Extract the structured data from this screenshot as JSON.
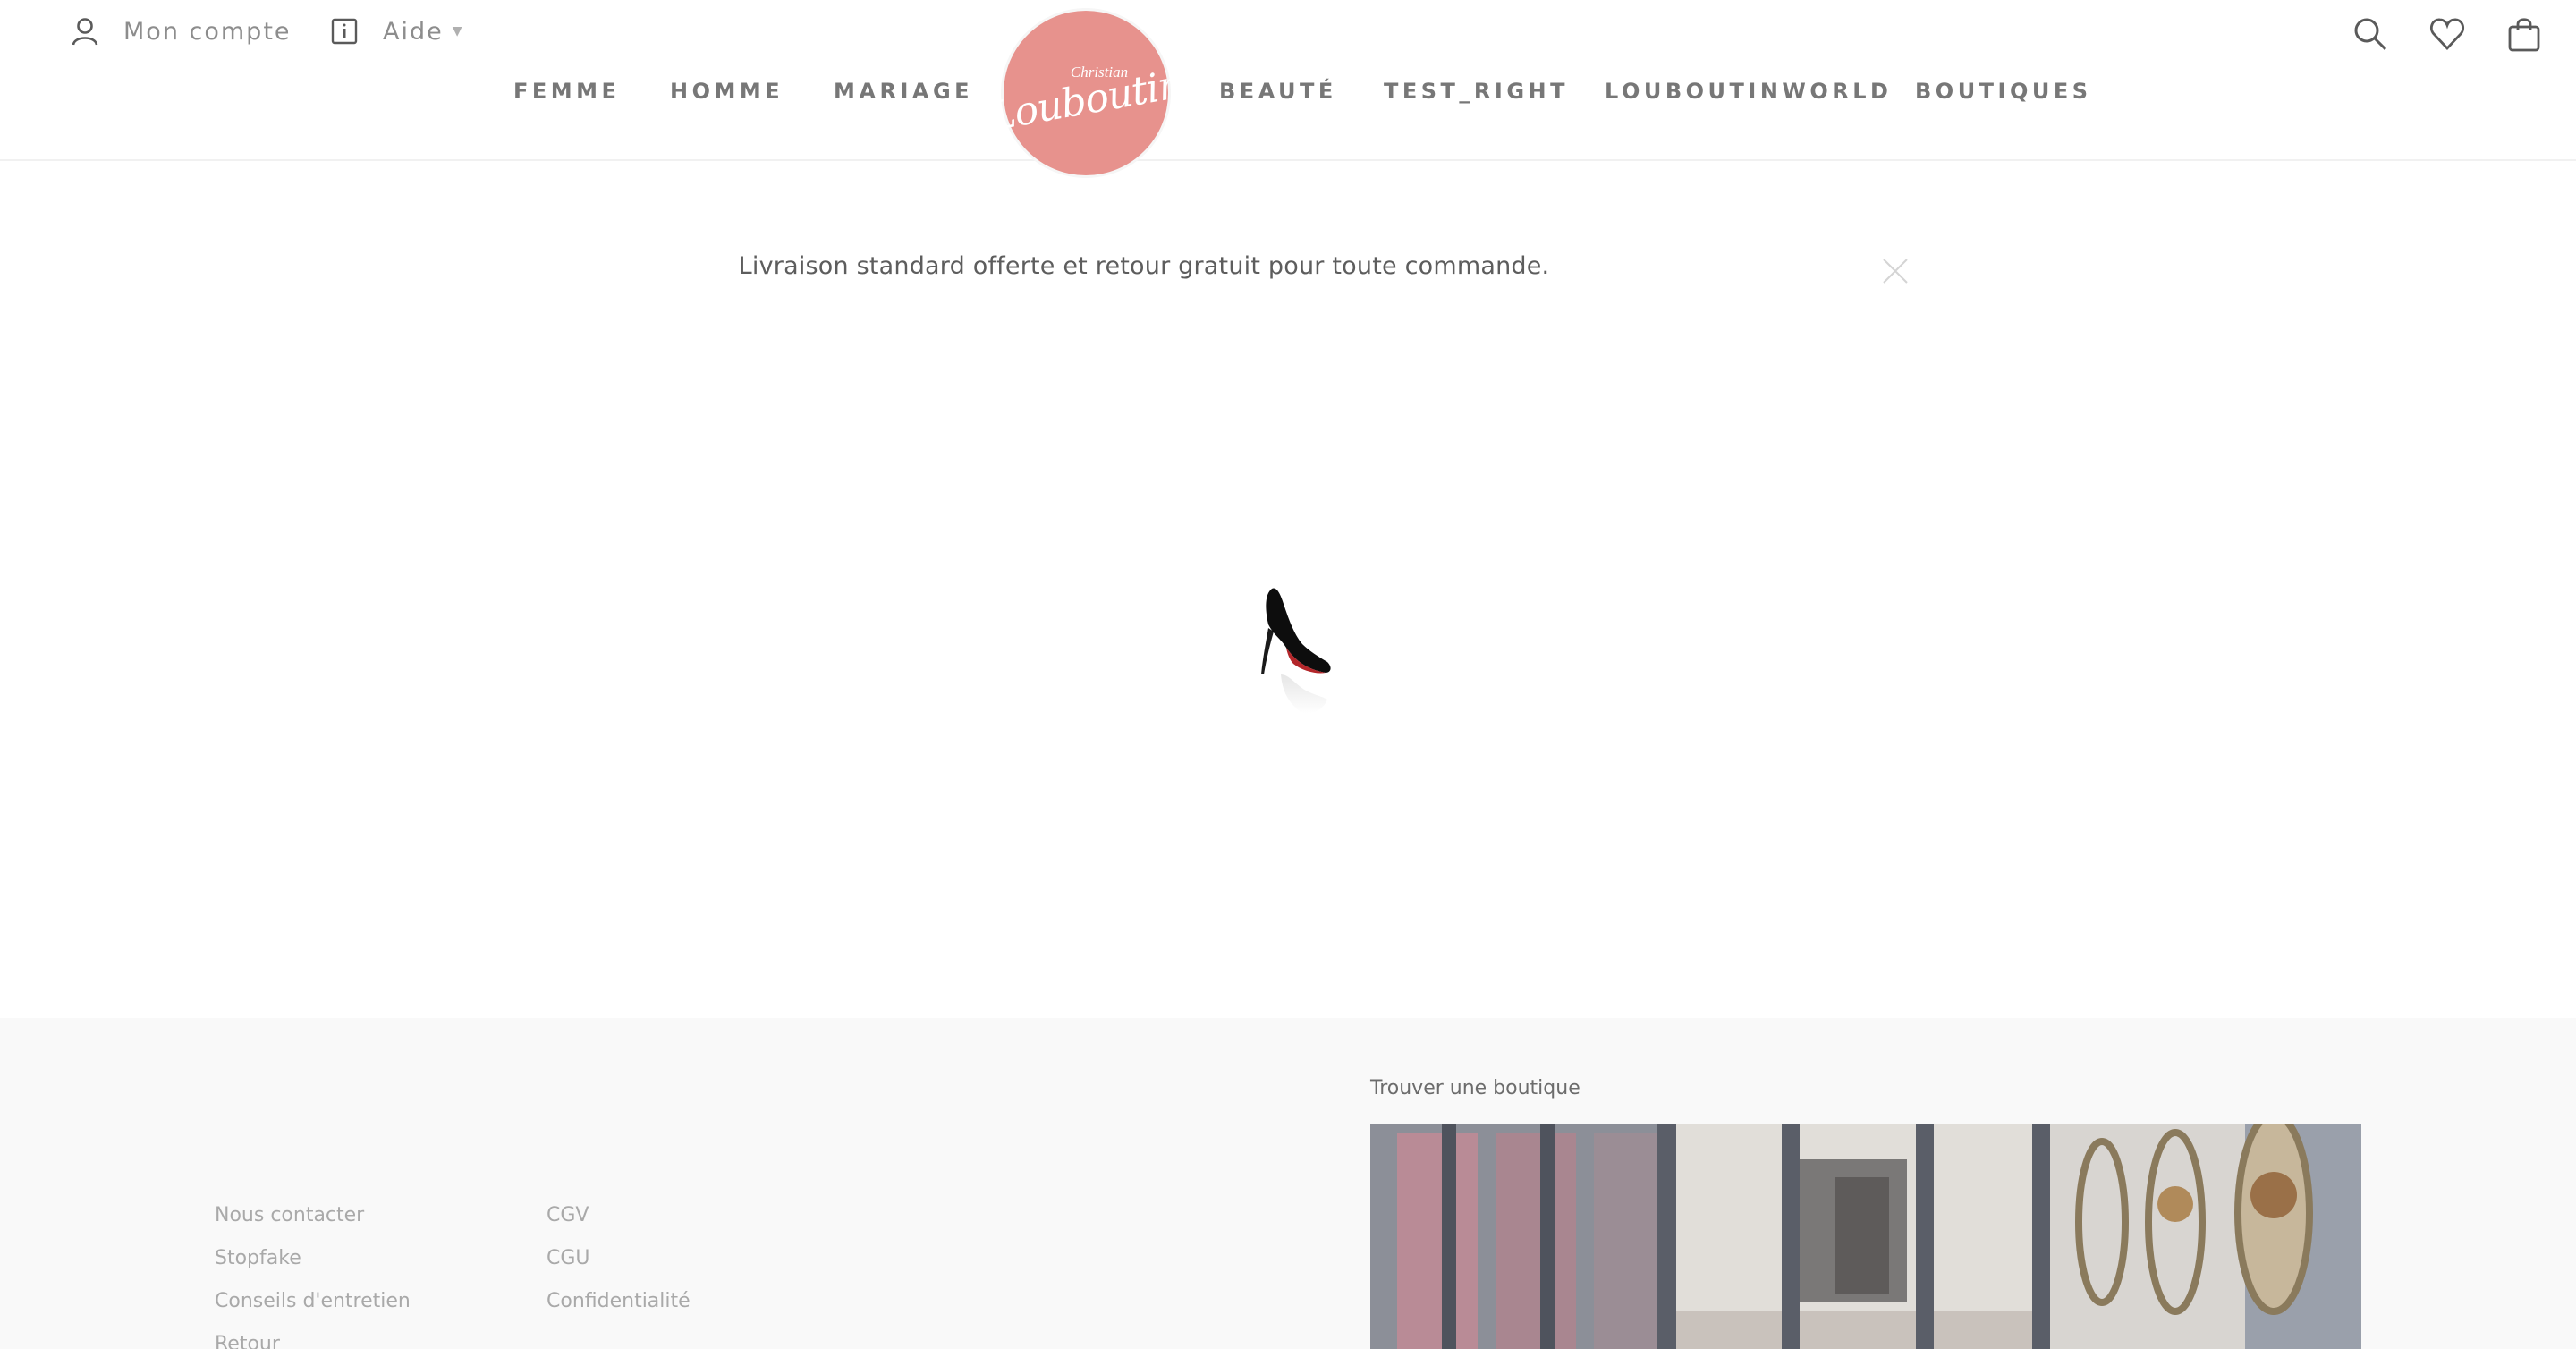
{
  "header": {
    "account_label": "Mon compte",
    "help_label": "Aide",
    "logo_small_text": "Christian",
    "logo_big_text": "Louboutin",
    "brand_color": "#e7928d",
    "icons": [
      "user-icon",
      "info-icon",
      "search-icon",
      "heart-icon",
      "bag-icon"
    ]
  },
  "nav": {
    "items": [
      {
        "label": "FEMME"
      },
      {
        "label": "HOMME"
      },
      {
        "label": "MARIAGE"
      },
      {
        "label": "BEAUTÉ"
      },
      {
        "label": "TEST_RIGHT"
      },
      {
        "label": "LOUBOUTINWORLD"
      },
      {
        "label": "BOUTIQUES"
      }
    ]
  },
  "banner": {
    "text": "Livraison standard offerte et retour gratuit pour toute commande."
  },
  "footer": {
    "col1": [
      "Nous contacter",
      "Stopfake",
      "Conseils d'entretien",
      "Retour"
    ],
    "col2": [
      "CGV",
      "CGU",
      "Confidentialité"
    ],
    "store_title": "Trouver une boutique"
  }
}
